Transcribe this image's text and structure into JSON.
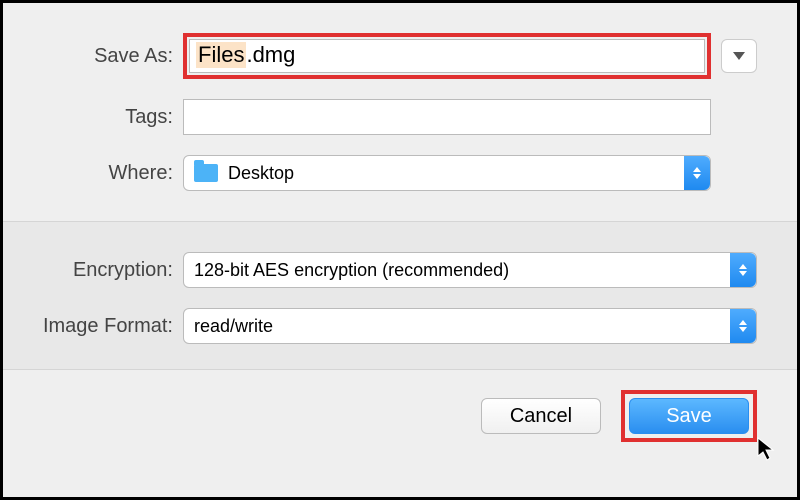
{
  "labels": {
    "save_as": "Save As:",
    "tags": "Tags:",
    "where": "Where:",
    "encryption": "Encryption:",
    "image_format": "Image Format:"
  },
  "fields": {
    "filename_base": "Files",
    "filename_ext": ".dmg",
    "tags_value": "",
    "where_value": "Desktop",
    "encryption_value": "128-bit AES encryption (recommended)",
    "image_format_value": "read/write"
  },
  "buttons": {
    "cancel": "Cancel",
    "save": "Save"
  },
  "icons": {
    "folder": "folder-icon",
    "expand": "chevron-down-icon",
    "stepper": "updown-icon",
    "cursor": "cursor-arrow-icon"
  }
}
